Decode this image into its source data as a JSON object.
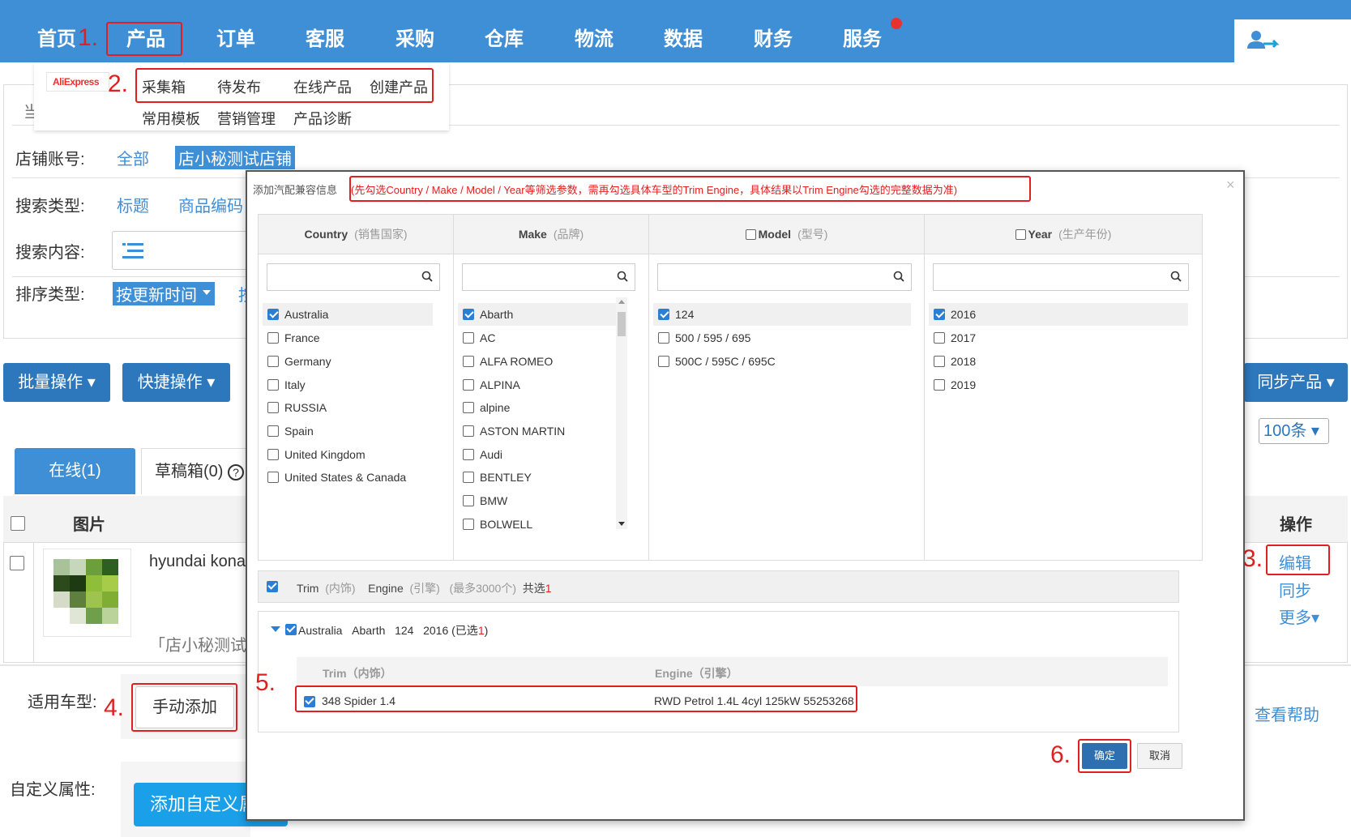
{
  "nav": {
    "items": [
      "首页",
      "产品",
      "订单",
      "客服",
      "采购",
      "仓库",
      "物流",
      "数据",
      "财务",
      "服务"
    ]
  },
  "subnav": {
    "logo": "AliExpress",
    "row1": [
      "采集箱",
      "待发布",
      "在线产品",
      "创建产品"
    ],
    "row2": [
      "常用模板",
      "营销管理",
      "产品诊断"
    ]
  },
  "steps": [
    "1.",
    "2.",
    "3.",
    "4.",
    "5.",
    "6."
  ],
  "filters": {
    "breadcrumb_char": "当",
    "shop_label": "店铺账号:",
    "shop_all": "全部",
    "shop_selected": "店小秘测试店铺",
    "search_type_label": "搜索类型:",
    "search_type_title": "标题",
    "search_type_code": "商品编码",
    "search_content_label": "搜索内容:",
    "sort_label": "排序类型:",
    "sort_selected": "按更新时间",
    "sort_second_char": "按"
  },
  "toolbar": {
    "batch": "批量操作",
    "quick": "快捷操作",
    "sync": "同步产品",
    "page_size": "100条"
  },
  "tabs": {
    "online": "在线(1)",
    "draft": "草稿箱(0)"
  },
  "table": {
    "col_image": "图片",
    "col_action": "操作",
    "row_title": "hyundai kona",
    "row_shop": "「店小秘测试",
    "action_edit": "编辑",
    "action_sync": "同步",
    "action_more": "更多"
  },
  "form": {
    "vehicle_label": "适用车型:",
    "manual_add": "手动添加",
    "help": "查看帮助",
    "custom_label": "自定义属性:",
    "add_custom": "添加自定义属"
  },
  "modal": {
    "title": "添加汽配兼容信息",
    "hint": "(先勾选Country / Make / Model / Year等筛选参数，需再勾选具体车型的Trim Engine，具体结果以Trim Engine勾选的完整数据为准)",
    "close": "×",
    "country": {
      "head": "Country",
      "head_sub": "(销售国家)",
      "options": [
        "Australia",
        "France",
        "Germany",
        "Italy",
        "RUSSIA",
        "Spain",
        "United Kingdom",
        "United States & Canada"
      ]
    },
    "make": {
      "head": "Make",
      "head_sub": "(品牌)",
      "options": [
        "Abarth",
        "AC",
        "ALFA ROMEO",
        "ALPINA",
        "alpine",
        "ASTON MARTIN",
        "Audi",
        "BENTLEY",
        "BMW",
        "BOLWELL"
      ]
    },
    "model": {
      "head": "Model",
      "head_sub": "(型号)",
      "options": [
        "124",
        "500 / 595 / 695",
        "500C / 595C / 695C"
      ]
    },
    "year": {
      "head": "Year",
      "head_sub": "(生产年份)",
      "options": [
        "2016",
        "2017",
        "2018",
        "2019"
      ]
    },
    "trim_bar": {
      "trim": "Trim",
      "trim_sub": "(内饰)",
      "engine": "Engine",
      "engine_sub": "(引擎)",
      "max": "(最多3000个)",
      "total_label": "共选",
      "total": "1"
    },
    "group": {
      "country": "Australia",
      "make": "Abarth",
      "model": "124",
      "year": "2016",
      "sel_prefix": "(已选",
      "sel_count": "1",
      "sel_suffix": ")"
    },
    "detail": {
      "trim_head": "Trim（内饰）",
      "engine_head": "Engine（引擎）",
      "trim": "348 Spider 1.4",
      "engine": "RWD Petrol 1.4L 4cyl 125kW 55253268"
    },
    "ok": "确定",
    "cancel": "取消"
  }
}
